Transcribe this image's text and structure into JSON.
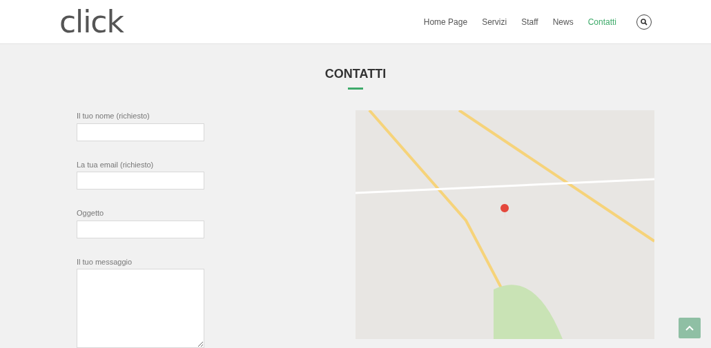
{
  "header": {
    "logo": "click",
    "nav": [
      {
        "label": "Home Page",
        "selected": false
      },
      {
        "label": "Servizi",
        "selected": false
      },
      {
        "label": "Staff",
        "selected": false
      },
      {
        "label": "News",
        "selected": false
      },
      {
        "label": "Contatti",
        "selected": true
      }
    ]
  },
  "title": "CONTATTI",
  "form": {
    "fields": [
      {
        "label": "Il tuo nome (richiesto)",
        "kind": "text"
      },
      {
        "label": "La tua email (richiesto)",
        "kind": "text"
      },
      {
        "label": "Oggetto",
        "kind": "text"
      },
      {
        "label": "Il tuo messaggio",
        "kind": "textarea"
      }
    ]
  }
}
